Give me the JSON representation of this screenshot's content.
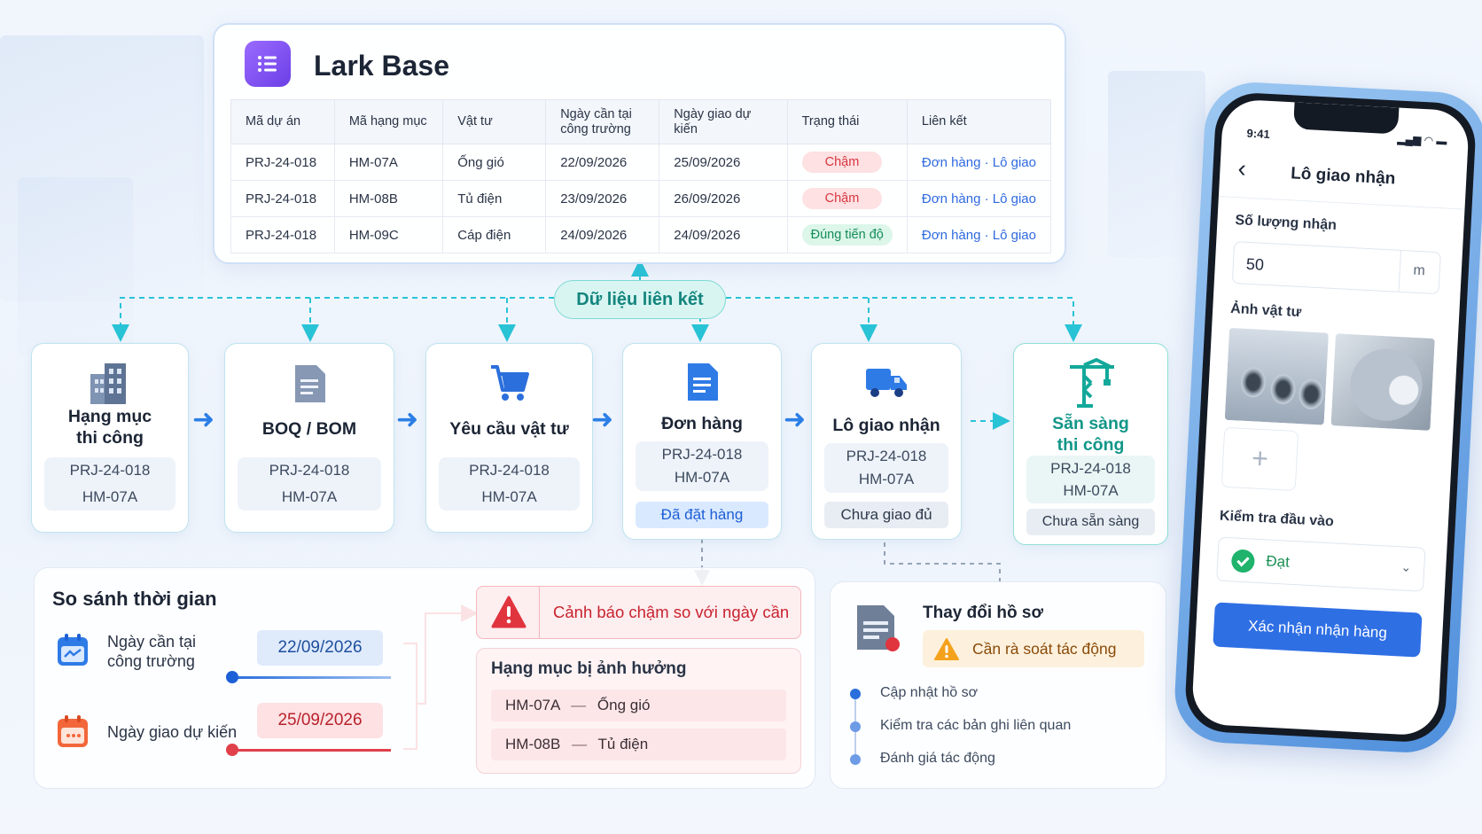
{
  "lark_base": {
    "title": "Lark Base",
    "columns": [
      "Mã dự án",
      "Mã hạng mục",
      "Vật tư",
      "Ngày cần tại\ncông trường",
      "Ngày giao dự kiến",
      "Trạng thái",
      "Liên kết"
    ],
    "rows": [
      {
        "project": "PRJ-24-018",
        "item": "HM-07A",
        "material": "Ống gió",
        "need_date": "22/09/2026",
        "eta": "25/09/2026",
        "status": "Chậm",
        "status_color": "#d8363f",
        "link": "Đơn hàng · Lô giao"
      },
      {
        "project": "PRJ-24-018",
        "item": "HM-08B",
        "material": "Tủ điện",
        "need_date": "23/09/2026",
        "eta": "26/09/2026",
        "status": "Chậm",
        "status_color": "#d8363f",
        "link": "Đơn hàng · Lô giao"
      },
      {
        "project": "PRJ-24-018",
        "item": "HM-09C",
        "material": "Cáp điện",
        "need_date": "24/09/2026",
        "eta": "24/09/2026",
        "status": "Đúng tiến độ",
        "status_color": "#148d58",
        "link": "Đơn hàng · Lô giao"
      }
    ]
  },
  "linked_data_label": "Dữ liệu liên kết",
  "flow": [
    {
      "title": "Hạng mục\nthi công",
      "icon": "building-icon",
      "ids": [
        "PRJ-24-018",
        "HM-07A"
      ],
      "status": ""
    },
    {
      "title": "BOQ / BOM",
      "icon": "document-icon",
      "ids": [
        "PRJ-24-018",
        "HM-07A"
      ],
      "status": ""
    },
    {
      "title": "Yêu cầu vật tư",
      "icon": "cart-icon",
      "ids": [
        "PRJ-24-018",
        "HM-07A"
      ],
      "status": ""
    },
    {
      "title": "Đơn hàng",
      "icon": "order-document-icon",
      "ids": [
        "PRJ-24-018",
        "HM-07A"
      ],
      "status": "Đã đặt hàng"
    },
    {
      "title": "Lô giao nhận",
      "icon": "truck-icon",
      "ids": [
        "PRJ-24-018",
        "HM-07A"
      ],
      "status": "Chưa giao đủ"
    },
    {
      "title": "Sẵn sàng\nthi công",
      "icon": "crane-icon",
      "ids": [
        "PRJ-24-018",
        "HM-07A"
      ],
      "status": "Chưa sẵn sàng"
    }
  ],
  "time_compare": {
    "title": "So sánh thời gian",
    "need_label": "Ngày cần tại\ncông trường",
    "need_date": "22/09/2026",
    "eta_label": "Ngày giao dự kiến",
    "eta_date": "25/09/2026"
  },
  "warning": {
    "text": "Cảnh báo chậm so với ngày cần",
    "affected_title": "Hạng mục bị ảnh hưởng",
    "affected": [
      {
        "code": "HM-07A",
        "name": "Ống gió"
      },
      {
        "code": "HM-08B",
        "name": "Tủ điện"
      }
    ]
  },
  "change": {
    "title": "Thay đổi hồ sơ",
    "badge": "Cần rà soát tác động",
    "steps": [
      "Cập nhật hồ sơ",
      "Kiểm tra các bản ghi liên quan",
      "Đánh giá tác động"
    ]
  },
  "phone": {
    "time": "9:41",
    "title": "Lô giao nhận",
    "qty_label": "Số lượng nhận",
    "qty_value": "50",
    "qty_unit": "m",
    "photo_label": "Ảnh vật tư",
    "add_photo": "+",
    "inspect_label": "Kiểm tra đầu vào",
    "inspect_value": "Đạt",
    "confirm_button": "Xác nhận nhận hàng",
    "accent": "#2f6fe4"
  }
}
